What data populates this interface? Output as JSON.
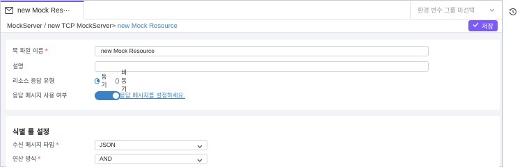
{
  "tab": {
    "label": "new Mock Res···"
  },
  "env_select": {
    "placeholder": "환경 변수 그룹 미선택"
  },
  "breadcrumb": {
    "path": "MockServer / new TCP MockServer> ",
    "current": "new Mock Resource"
  },
  "toolbar": {
    "save_label": "저장"
  },
  "form": {
    "file_name_label": "목 파일 이름",
    "file_name_value": "new Mock Resource",
    "description_label": "설명",
    "description_value": "",
    "response_type_label": "리소스 응답 유형",
    "response_type_options": [
      "동기",
      "비동기"
    ],
    "response_type_selected": "동기",
    "response_msg_label": "응답 메시지 사용 여부",
    "response_msg_enabled": true,
    "response_msg_link": "응답 메시지를 설정하세요."
  },
  "identify_rules": {
    "title": "식별 룰 설정",
    "msg_type_label": "수신 메시지 타입",
    "msg_type_value": "JSON",
    "operation_label": "연산 방식",
    "operation_value": "AND"
  },
  "colors": {
    "accent": "#7a5af8",
    "link": "#3b82c4",
    "required": "#e05252"
  }
}
